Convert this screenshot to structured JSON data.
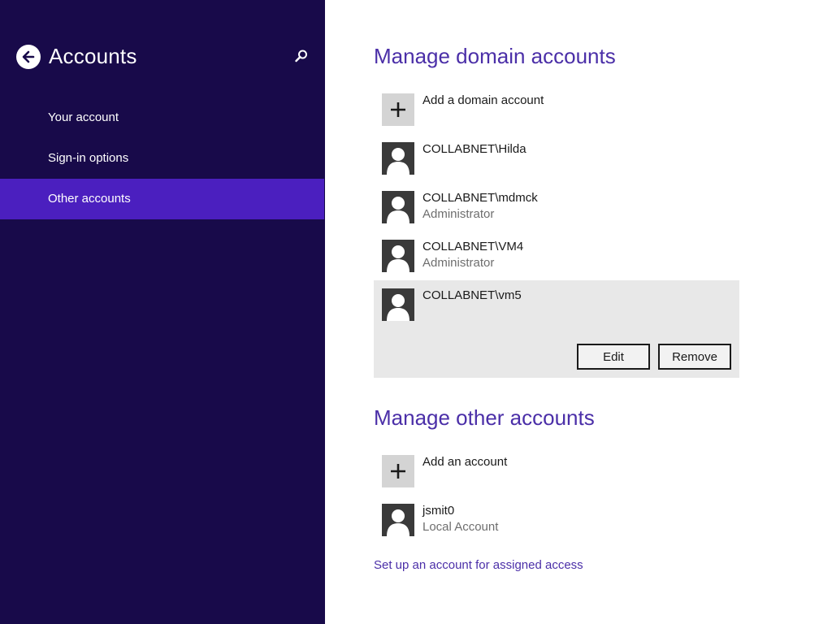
{
  "sidebar": {
    "title": "Accounts",
    "back_icon": "back-arrow-icon",
    "search_icon": "search-icon",
    "nav_items": [
      {
        "label": "Your account",
        "selected": false
      },
      {
        "label": "Sign-in options",
        "selected": false
      },
      {
        "label": "Other accounts",
        "selected": true
      }
    ]
  },
  "domain_section": {
    "title": "Manage domain accounts",
    "add_label": "Add a domain account",
    "accounts": [
      {
        "name": "COLLABNET\\Hilda",
        "role": ""
      },
      {
        "name": "COLLABNET\\mdmck",
        "role": "Administrator"
      },
      {
        "name": "COLLABNET\\VM4",
        "role": "Administrator"
      },
      {
        "name": "COLLABNET\\vm5",
        "role": "",
        "expanded": true
      }
    ],
    "edit_label": "Edit",
    "remove_label": "Remove"
  },
  "other_section": {
    "title": "Manage other accounts",
    "add_label": "Add an account",
    "accounts": [
      {
        "name": "jsmit0",
        "role": "Local Account"
      }
    ]
  },
  "assigned_access_link": "Set up an account for assigned access",
  "colors": {
    "sidebar_bg": "#180a4a",
    "nav_selected": "#4b1fbf",
    "accent_text": "#4b2fa8",
    "expanded_row_bg": "#e8e8e8"
  }
}
